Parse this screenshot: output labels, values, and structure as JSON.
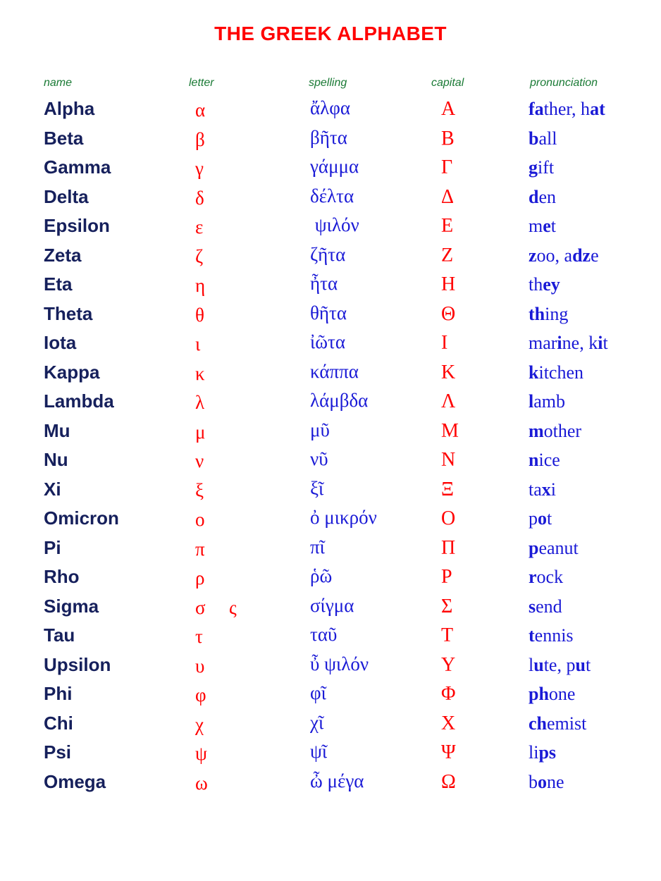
{
  "title": "THE GREEK ALPHABET",
  "colors": {
    "title": "#ff0000",
    "header": "#1a7a35",
    "name": "#16205c",
    "letter": "#ff0000",
    "capital": "#ff0000",
    "spelling": "#1a1ad6",
    "pronunciation": "#1a1ad6",
    "background": "#ffffff"
  },
  "headers": {
    "name": "name",
    "letter": "letter",
    "spelling": "spelling",
    "capital": "capital",
    "pronunciation": "pronunciation"
  },
  "rows": [
    {
      "name": "Alpha",
      "letter": "α",
      "letter_alt": "",
      "spelling": "ἄλφα",
      "capital": "Α",
      "pronunciation": "father, hat",
      "pronunciation_parts": [
        {
          "text": "fa",
          "bold": true
        },
        {
          "text": "ther, h",
          "bold": false
        },
        {
          "text": "at",
          "bold": true
        }
      ]
    },
    {
      "name": "Beta",
      "letter": "β",
      "letter_alt": "",
      "spelling": "βῆτα",
      "capital": "Β",
      "pronunciation": "ball",
      "pronunciation_parts": [
        {
          "text": "b",
          "bold": true
        },
        {
          "text": "all",
          "bold": false
        }
      ]
    },
    {
      "name": "Gamma",
      "letter": "γ",
      "letter_alt": "",
      "spelling": "γάμμα",
      "capital": "Γ",
      "pronunciation": "gift",
      "pronunciation_parts": [
        {
          "text": "g",
          "bold": true
        },
        {
          "text": "ift",
          "bold": false
        }
      ]
    },
    {
      "name": "Delta",
      "letter": "δ",
      "letter_alt": "",
      "spelling": "δέλτα",
      "capital": "Δ",
      "pronunciation": "den",
      "pronunciation_parts": [
        {
          "text": "d",
          "bold": true
        },
        {
          "text": "en",
          "bold": false
        }
      ]
    },
    {
      "name": "Epsilon",
      "letter": "ε",
      "letter_alt": "",
      "spelling": "἖ ψιλόν",
      "capital": "Ε",
      "pronunciation": "met",
      "pronunciation_parts": [
        {
          "text": "m",
          "bold": false
        },
        {
          "text": "e",
          "bold": true
        },
        {
          "text": "t",
          "bold": false
        }
      ]
    },
    {
      "name": "Zeta",
      "letter": "ζ",
      "letter_alt": "",
      "spelling": "ζῆτα",
      "capital": "Ζ",
      "pronunciation": "zoo, adze",
      "pronunciation_parts": [
        {
          "text": "z",
          "bold": true
        },
        {
          "text": "oo, a",
          "bold": false
        },
        {
          "text": "dz",
          "bold": true
        },
        {
          "text": "e",
          "bold": false
        }
      ]
    },
    {
      "name": "Eta",
      "letter": "η",
      "letter_alt": "",
      "spelling": "ἦτα",
      "capital": "Η",
      "pronunciation": "they",
      "pronunciation_parts": [
        {
          "text": "th",
          "bold": false
        },
        {
          "text": "ey",
          "bold": true
        }
      ]
    },
    {
      "name": "Theta",
      "letter": "θ",
      "letter_alt": "",
      "spelling": "θῆτα",
      "capital": "Θ",
      "pronunciation": "thing",
      "pronunciation_parts": [
        {
          "text": "th",
          "bold": true
        },
        {
          "text": "ing",
          "bold": false
        }
      ]
    },
    {
      "name": "Iota",
      "letter": "ι",
      "letter_alt": "",
      "spelling": "ἰῶτα",
      "capital": "Ι",
      "pronunciation": "marine, kit",
      "pronunciation_parts": [
        {
          "text": "mar",
          "bold": false
        },
        {
          "text": "i",
          "bold": true
        },
        {
          "text": "ne, k",
          "bold": false
        },
        {
          "text": "i",
          "bold": true
        },
        {
          "text": "t",
          "bold": false
        }
      ]
    },
    {
      "name": "Kappa",
      "letter": "κ",
      "letter_alt": "",
      "spelling": "κάππα",
      "capital": "Κ",
      "pronunciation": "kitchen",
      "pronunciation_parts": [
        {
          "text": "k",
          "bold": true
        },
        {
          "text": "itchen",
          "bold": false
        }
      ]
    },
    {
      "name": "Lambda",
      "letter": "λ",
      "letter_alt": "",
      "spelling": "λάμβδα",
      "capital": "Λ",
      "pronunciation": "lamb",
      "pronunciation_parts": [
        {
          "text": "l",
          "bold": true
        },
        {
          "text": "amb",
          "bold": false
        }
      ]
    },
    {
      "name": "Mu",
      "letter": "μ",
      "letter_alt": "",
      "spelling": "μῦ",
      "capital": "Μ",
      "pronunciation": "mother",
      "pronunciation_parts": [
        {
          "text": "m",
          "bold": true
        },
        {
          "text": "other",
          "bold": false
        }
      ]
    },
    {
      "name": "Nu",
      "letter": "ν",
      "letter_alt": "",
      "spelling": "νῦ",
      "capital": "Ν",
      "pronunciation": "nice",
      "pronunciation_parts": [
        {
          "text": "n",
          "bold": true
        },
        {
          "text": "ice",
          "bold": false
        }
      ]
    },
    {
      "name": "Xi",
      "letter": "ξ",
      "letter_alt": "",
      "spelling": "ξῖ",
      "capital": "Ξ",
      "pronunciation": "taxi",
      "pronunciation_parts": [
        {
          "text": "ta",
          "bold": false
        },
        {
          "text": "x",
          "bold": true
        },
        {
          "text": "i",
          "bold": false
        }
      ]
    },
    {
      "name": "Omicron",
      "letter": "ο",
      "letter_alt": "",
      "spelling": "ὀ μικρόν",
      "capital": "Ο",
      "pronunciation": "pot",
      "pronunciation_parts": [
        {
          "text": "p",
          "bold": false
        },
        {
          "text": "o",
          "bold": true
        },
        {
          "text": "t",
          "bold": false
        }
      ]
    },
    {
      "name": "Pi",
      "letter": "π",
      "letter_alt": "",
      "spelling": "πῖ",
      "capital": "Π",
      "pronunciation": "peanut",
      "pronunciation_parts": [
        {
          "text": "p",
          "bold": true
        },
        {
          "text": "eanut",
          "bold": false
        }
      ]
    },
    {
      "name": "Rho",
      "letter": "ρ",
      "letter_alt": "",
      "spelling": "ῥῶ",
      "capital": "Ρ",
      "pronunciation": "rock",
      "pronunciation_parts": [
        {
          "text": "r",
          "bold": true
        },
        {
          "text": "ock",
          "bold": false
        }
      ]
    },
    {
      "name": "Sigma",
      "letter": "σ",
      "letter_alt": "ς",
      "spelling": "σίγμα",
      "capital": "Σ",
      "pronunciation": "send",
      "pronunciation_parts": [
        {
          "text": "s",
          "bold": true
        },
        {
          "text": "end",
          "bold": false
        }
      ]
    },
    {
      "name": "Tau",
      "letter": "τ",
      "letter_alt": "",
      "spelling": "ταῦ",
      "capital": "Τ",
      "pronunciation": "tennis",
      "pronunciation_parts": [
        {
          "text": "t",
          "bold": true
        },
        {
          "text": "ennis",
          "bold": false
        }
      ]
    },
    {
      "name": "Upsilon",
      "letter": "υ",
      "letter_alt": "",
      "spelling": "ὖ ψιλόν",
      "capital": "Υ",
      "pronunciation": "lute, put",
      "pronunciation_parts": [
        {
          "text": "l",
          "bold": false
        },
        {
          "text": "u",
          "bold": true
        },
        {
          "text": "te, p",
          "bold": false
        },
        {
          "text": "u",
          "bold": true
        },
        {
          "text": "t",
          "bold": false
        }
      ]
    },
    {
      "name": "Phi",
      "letter": "φ",
      "letter_alt": "",
      "spelling": "φῖ",
      "capital": "Φ",
      "pronunciation": "phone",
      "pronunciation_parts": [
        {
          "text": "ph",
          "bold": true
        },
        {
          "text": "one",
          "bold": false
        }
      ]
    },
    {
      "name": "Chi",
      "letter": "χ",
      "letter_alt": "",
      "spelling": "χῖ",
      "capital": "Χ",
      "pronunciation": "chemist",
      "pronunciation_parts": [
        {
          "text": "ch",
          "bold": true
        },
        {
          "text": "emist",
          "bold": false
        }
      ]
    },
    {
      "name": "Psi",
      "letter": "ψ",
      "letter_alt": "",
      "spelling": "ψῖ",
      "capital": "Ψ",
      "pronunciation": "lips",
      "pronunciation_parts": [
        {
          "text": "li",
          "bold": false
        },
        {
          "text": "ps",
          "bold": true
        }
      ]
    },
    {
      "name": "Omega",
      "letter": "ω",
      "letter_alt": "",
      "spelling": "ὦ μέγα",
      "capital": "Ω",
      "pronunciation": "bone",
      "pronunciation_parts": [
        {
          "text": "b",
          "bold": false
        },
        {
          "text": "o",
          "bold": true
        },
        {
          "text": "ne",
          "bold": false
        }
      ]
    }
  ]
}
